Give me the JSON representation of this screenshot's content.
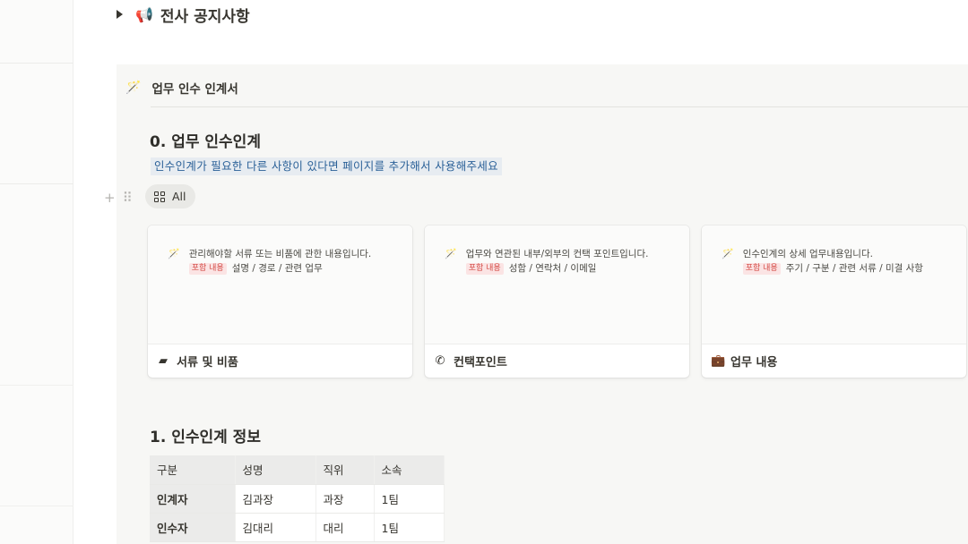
{
  "toggle": {
    "title": "전사 공지사항"
  },
  "callout": {
    "title": "업무 인수 인계서"
  },
  "section0": {
    "heading": "0. 업무 인수인계",
    "hint": "인수인계가 필요한 다른 사항이 있다면 페이지를 추가해서 사용해주세요",
    "view_tab": "All"
  },
  "cards": [
    {
      "preview_line1": "관리해야할 서류 또는 비품에 관한 내용입니다.",
      "tag": "포함 내용",
      "preview_line2": "설명 / 경로 / 관련 업무",
      "title": "서류 및 비품",
      "icon": "note-icon"
    },
    {
      "preview_line1": "업무와 연관된 내부/외부의 컨택 포인트입니다.",
      "tag": "포함 내용",
      "preview_line2": "성함 / 연락처 / 이메일",
      "title": "컨택포인트",
      "icon": "phone-icon"
    },
    {
      "preview_line1": "인수인계의 상세 업무내용입니다.",
      "tag": "포함 내용",
      "preview_line2": "주기 / 구분 / 관련 서류 / 미결 사항",
      "title": "업무 내용",
      "icon": "briefcase-icon"
    }
  ],
  "section1": {
    "heading": "1. 인수인계 정보",
    "table": {
      "headers": [
        "구분",
        "성명",
        "직위",
        "소속"
      ],
      "rows": [
        [
          "인계자",
          "김과장",
          "과장",
          "1팀"
        ],
        [
          "인수자",
          "김대리",
          "대리",
          "1팀"
        ]
      ]
    }
  },
  "colors": {
    "hint_bg": "#e7ecf1",
    "hint_text": "#2b6198",
    "tag_red": "#d44c47",
    "callout_bg": "#f7f7f5"
  }
}
